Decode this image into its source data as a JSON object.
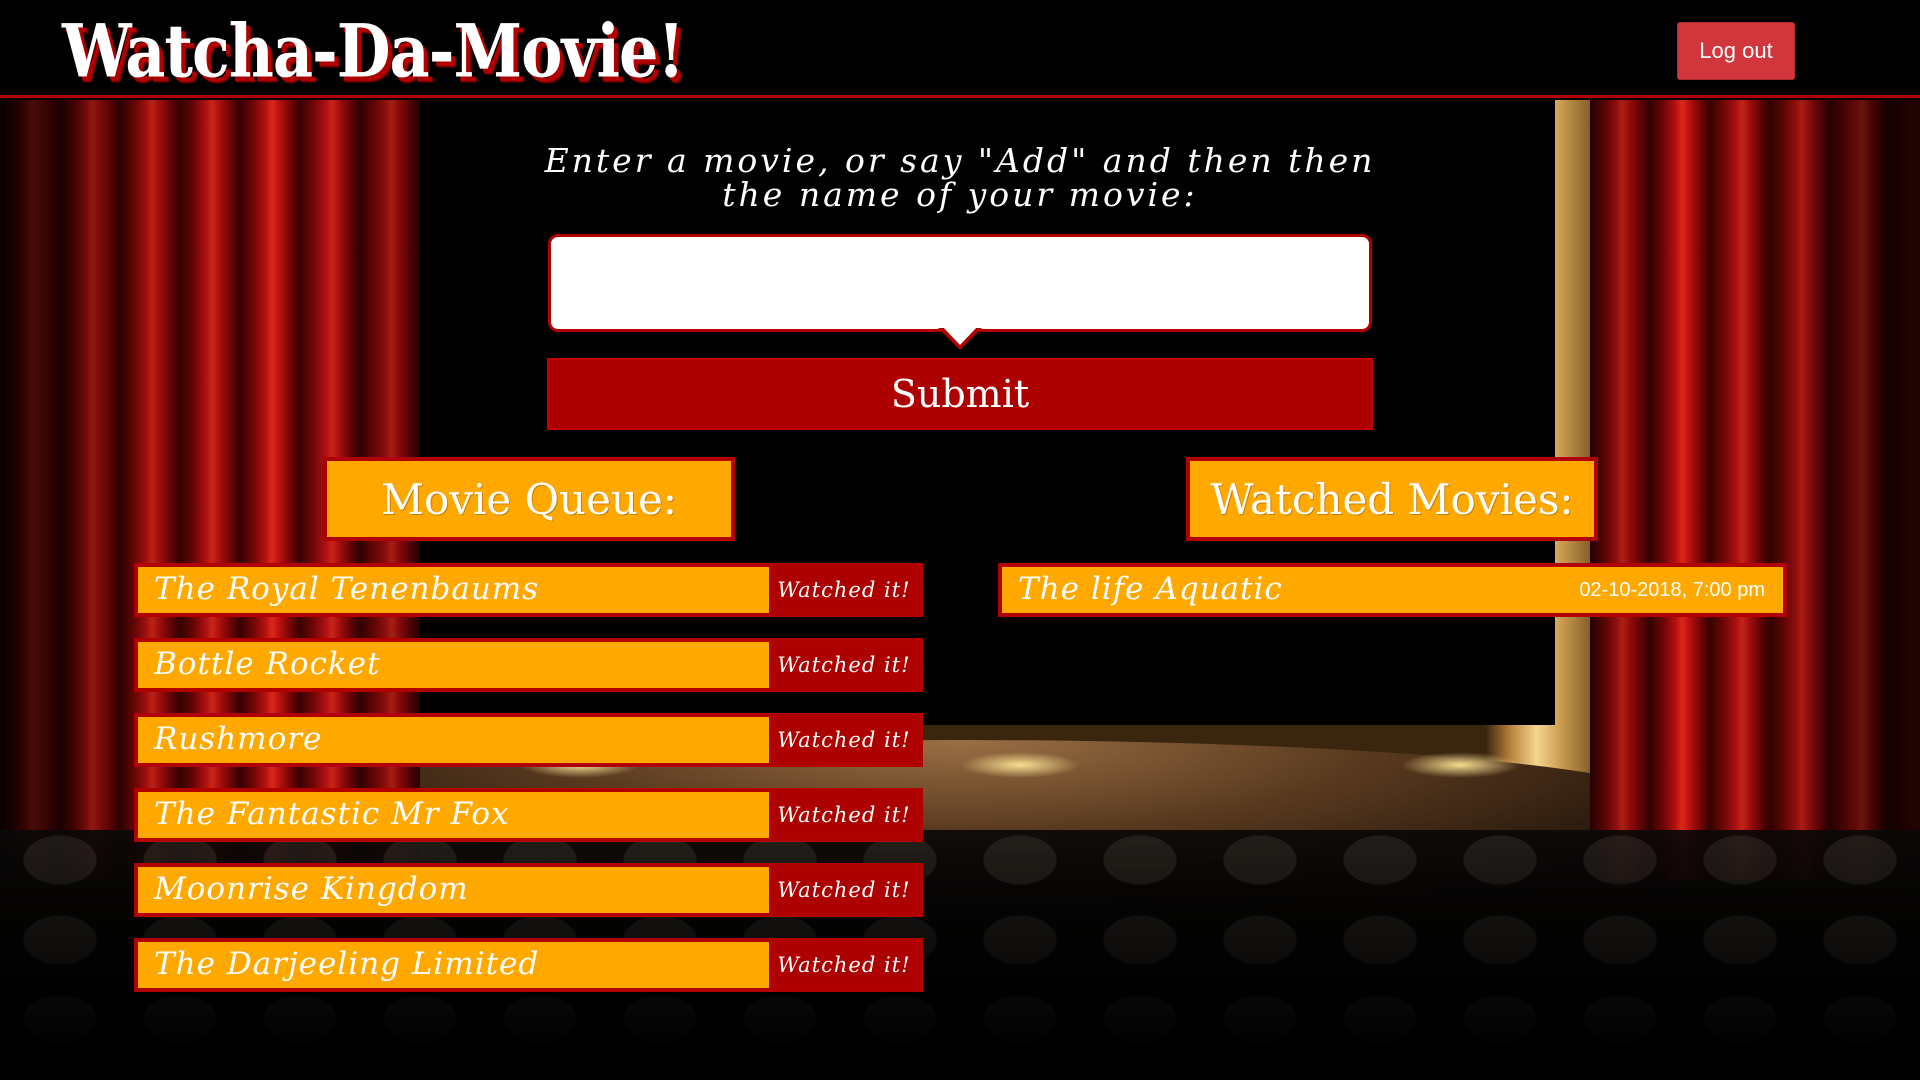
{
  "header": {
    "logo": "Watcha-Da-Movie!",
    "logout_label": "Log out"
  },
  "prompt": {
    "line1": "Enter a movie, or say \"Add\" and then then",
    "line2": "the name of your movie:"
  },
  "search": {
    "value": "",
    "placeholder": ""
  },
  "submit_label": "Submit",
  "queue": {
    "title": "Movie Queue:",
    "action_label": "Watched it!",
    "items": [
      "The Royal Tenenbaums",
      "Bottle Rocket",
      "Rushmore",
      "The Fantastic Mr Fox",
      "Moonrise Kingdom",
      "The Darjeeling Limited"
    ]
  },
  "watched": {
    "title": "Watched Movies:",
    "items": [
      {
        "title": "The life Aquatic",
        "date": "02-10-2018, 7:00 pm"
      }
    ]
  },
  "colors": {
    "accent_red": "#ad0000",
    "panel_orange": "#ffa800",
    "logout_red": "#d0363c"
  }
}
